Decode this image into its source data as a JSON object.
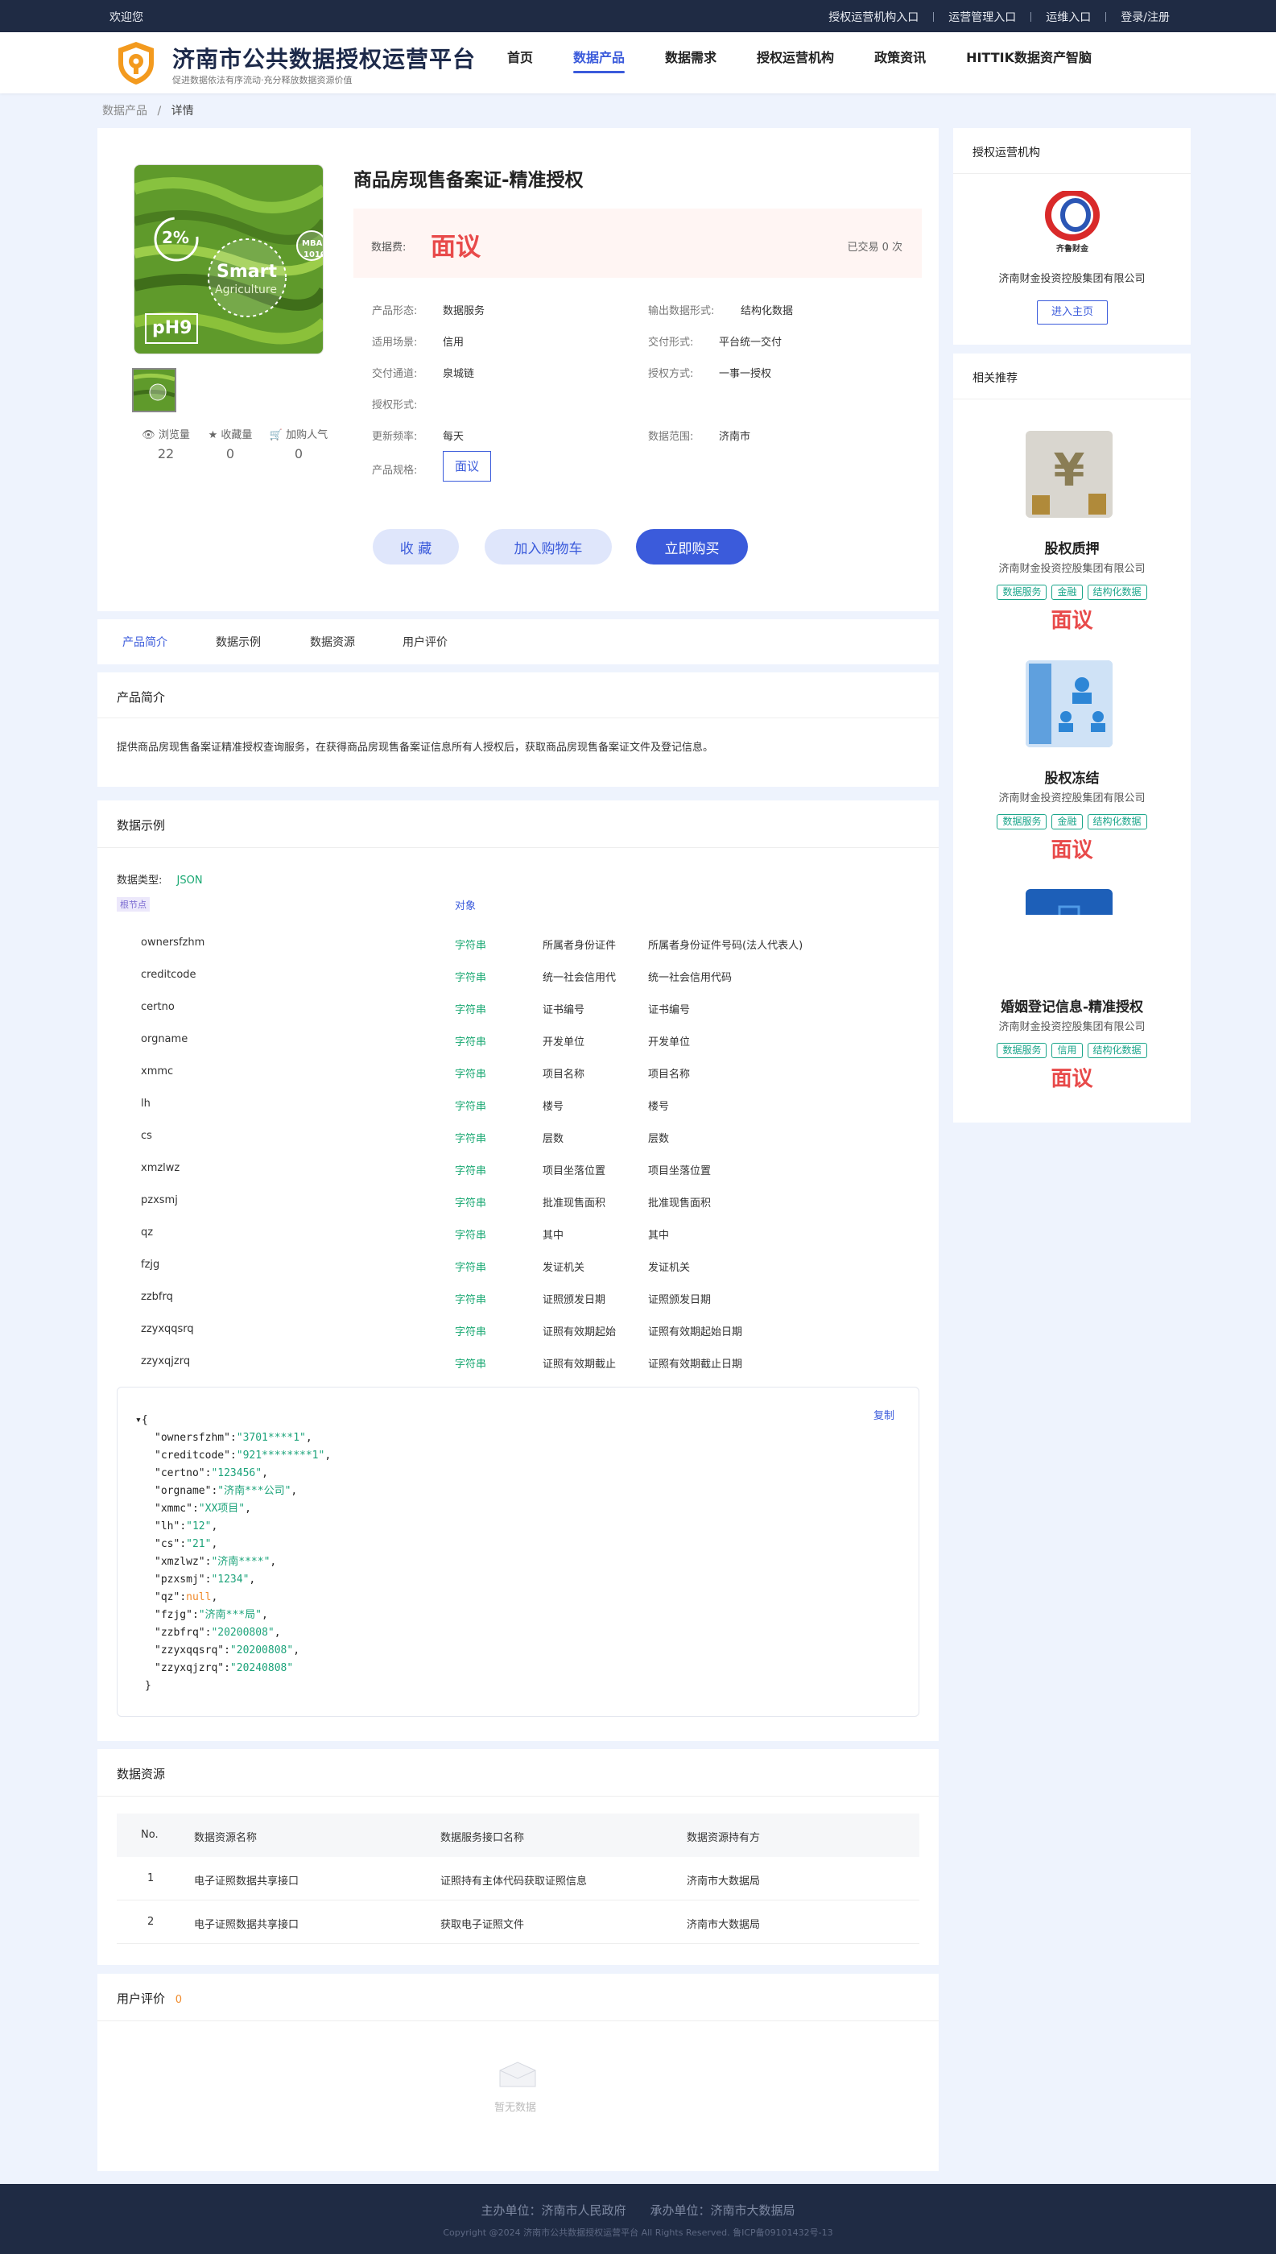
{
  "topbar": {
    "welcome": "欢迎您",
    "links": [
      "授权运营机构入口",
      "运营管理入口",
      "运维入口",
      "登录/注册"
    ]
  },
  "header": {
    "title": "济南市公共数据授权运营平台",
    "subtitle": "促进数据依法有序流动·充分释放数据资源价值",
    "nav": [
      "首页",
      "数据产品",
      "数据需求",
      "授权运营机构",
      "政策资讯",
      "HITTIK数据资产智脑"
    ],
    "active_nav": 1
  },
  "breadcrumb": {
    "parent": "数据产品",
    "sep": "/",
    "current": "详情"
  },
  "product": {
    "image_texts": [
      "2%",
      "Smart",
      "Agriculture",
      "pH9",
      "MBA",
      "1010"
    ],
    "stats": [
      {
        "label": "浏览量",
        "value": "22"
      },
      {
        "label": "收藏量",
        "value": "0"
      },
      {
        "label": "加购人气",
        "value": "0"
      }
    ],
    "title": "商品房现售备案证-精准授权",
    "fee_label": "数据费:",
    "fee_value": "面议",
    "traded": "已交易 0 次",
    "attrs": [
      {
        "label": "产品形态:",
        "value": "数据服务"
      },
      {
        "label": "输出数据形式:",
        "value": "结构化数据"
      },
      {
        "label": "适用场景:",
        "value": "信用"
      },
      {
        "label": "交付形式:",
        "value": "平台统一交付"
      },
      {
        "label": "交付通道:",
        "value": "泉城链"
      },
      {
        "label": "授权方式:",
        "value": "一事一授权"
      },
      {
        "label": "授权形式:",
        "value": ""
      },
      {
        "label": "更新频率:",
        "value": "每天"
      },
      {
        "label": "数据范围:",
        "value": "济南市"
      }
    ],
    "spec_label": "产品规格:",
    "spec_value": "面议",
    "buttons": {
      "fav": "收 藏",
      "cart": "加入购物车",
      "buy": "立即购买"
    }
  },
  "tabs": [
    "产品简介",
    "数据示例",
    "数据资源",
    "用户评价"
  ],
  "intro": {
    "title": "产品简介",
    "text": "提供商品房现售备案证精准授权查询服务，在获得商品房现售备案证信息所有人授权后，获取商品房现售备案证文件及登记信息。"
  },
  "sample": {
    "title": "数据示例",
    "type_label": "数据类型:",
    "type_value": "JSON",
    "root_badge": "根节点",
    "root_type": "对象",
    "fields": [
      {
        "name": "ownersfzhm",
        "type": "字符串",
        "cn": "所属者身份证件",
        "desc": "所属者身份证件号码(法人代表人)"
      },
      {
        "name": "creditcode",
        "type": "字符串",
        "cn": "统一社会信用代",
        "desc": "统一社会信用代码"
      },
      {
        "name": "certno",
        "type": "字符串",
        "cn": "证书编号",
        "desc": "证书编号"
      },
      {
        "name": "orgname",
        "type": "字符串",
        "cn": "开发单位",
        "desc": "开发单位"
      },
      {
        "name": "xmmc",
        "type": "字符串",
        "cn": "项目名称",
        "desc": "项目名称"
      },
      {
        "name": "lh",
        "type": "字符串",
        "cn": "楼号",
        "desc": "楼号"
      },
      {
        "name": "cs",
        "type": "字符串",
        "cn": "层数",
        "desc": "层数"
      },
      {
        "name": "xmzlwz",
        "type": "字符串",
        "cn": "项目坐落位置",
        "desc": "项目坐落位置"
      },
      {
        "name": "pzxsmj",
        "type": "字符串",
        "cn": "批准现售面积",
        "desc": "批准现售面积"
      },
      {
        "name": "qz",
        "type": "字符串",
        "cn": "其中",
        "desc": "其中"
      },
      {
        "name": "fzjg",
        "type": "字符串",
        "cn": "发证机关",
        "desc": "发证机关"
      },
      {
        "name": "zzbfrq",
        "type": "字符串",
        "cn": "证照颁发日期",
        "desc": "证照颁发日期"
      },
      {
        "name": "zzyxqqsrq",
        "type": "字符串",
        "cn": "证照有效期起始",
        "desc": "证照有效期起始日期"
      },
      {
        "name": "zzyxqjzrq",
        "type": "字符串",
        "cn": "证照有效期截止",
        "desc": "证照有效期截止日期"
      }
    ],
    "copy_label": "复制",
    "json_open": "{",
    "json_close": "}",
    "json_lines": [
      {
        "key": "\"ownersfzhm\"",
        "val": "\"3701****1\"",
        "null": false
      },
      {
        "key": "\"creditcode\"",
        "val": "\"921********1\"",
        "null": false
      },
      {
        "key": "\"certno\"",
        "val": "\"123456\"",
        "null": false
      },
      {
        "key": "\"orgname\"",
        "val": "\"济南***公司\"",
        "null": false
      },
      {
        "key": "\"xmmc\"",
        "val": "\"XX项目\"",
        "null": false
      },
      {
        "key": "\"lh\"",
        "val": "\"12\"",
        "null": false
      },
      {
        "key": "\"cs\"",
        "val": "\"21\"",
        "null": false
      },
      {
        "key": "\"xmzlwz\"",
        "val": "\"济南****\"",
        "null": false
      },
      {
        "key": "\"pzxsmj\"",
        "val": "\"1234\"",
        "null": false
      },
      {
        "key": "\"qz\"",
        "val": "null",
        "null": true
      },
      {
        "key": "\"fzjg\"",
        "val": "\"济南***局\"",
        "null": false
      },
      {
        "key": "\"zzbfrq\"",
        "val": "\"20200808\"",
        "null": false
      },
      {
        "key": "\"zzyxqqsrq\"",
        "val": "\"20200808\"",
        "null": false
      },
      {
        "key": "\"zzyxqjzrq\"",
        "val": "\"20240808\"",
        "null": false
      }
    ]
  },
  "resources": {
    "title": "数据资源",
    "headers": [
      "No.",
      "数据资源名称",
      "数据服务接口名称",
      "数据资源持有方"
    ],
    "rows": [
      [
        "1",
        "电子证照数据共享接口",
        "证照持有主体代码获取证照信息",
        "济南市大数据局"
      ],
      [
        "2",
        "电子证照数据共享接口",
        "获取电子证照文件",
        "济南市大数据局"
      ]
    ]
  },
  "reviews": {
    "title": "用户评价",
    "count": "0",
    "empty": "暂无数据"
  },
  "side": {
    "org_title": "授权运营机构",
    "org_logo_text": "齐鲁财金",
    "org_name": "济南财金投资控股集团有限公司",
    "org_btn": "进入主页",
    "rec_title": "相关推荐",
    "recs": [
      {
        "name": "股权质押",
        "company": "济南财金投资控股集团有限公司",
        "tags": [
          "数据服务",
          "金融",
          "结构化数据"
        ],
        "price": "面议"
      },
      {
        "name": "股权冻结",
        "company": "济南财金投资控股集团有限公司",
        "tags": [
          "数据服务",
          "金融",
          "结构化数据"
        ],
        "price": "面议"
      },
      {
        "name": "婚姻登记信息-精准授权",
        "company": "济南财金投资控股集团有限公司",
        "tags": [
          "数据服务",
          "信用",
          "结构化数据"
        ],
        "price": "面议"
      }
    ]
  },
  "footer": {
    "line1": "主办单位：济南市人民政府　　承办单位：济南市大数据局",
    "line2": "Copyright @2024 济南市公共数据授权运营平台 All Rights Reserved. 鲁ICP备09101432号-13"
  },
  "colors": {
    "primary": "#3b5bdb",
    "price": "#e84a4a",
    "green": "#19a872",
    "tag": "#1aa58a",
    "dark": "#1f2b44"
  }
}
